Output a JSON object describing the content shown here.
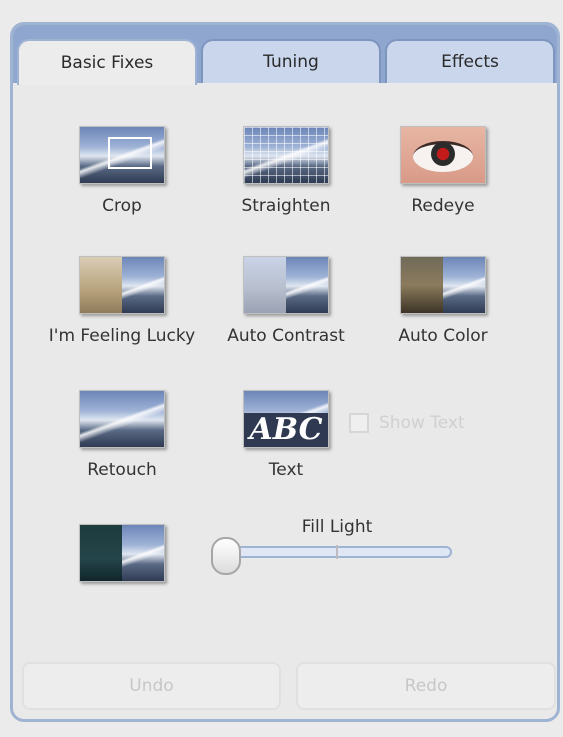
{
  "tabs": [
    {
      "label": "Basic Fixes",
      "active": true
    },
    {
      "label": "Tuning",
      "active": false
    },
    {
      "label": "Effects",
      "active": false
    }
  ],
  "tools": {
    "crop": "Crop",
    "straighten": "Straighten",
    "redeye": "Redeye",
    "feeling_lucky": "I'm Feeling Lucky",
    "auto_contrast": "Auto Contrast",
    "auto_color": "Auto Color",
    "retouch": "Retouch",
    "text": "Text",
    "text_thumb": "ABC"
  },
  "show_text": {
    "label": "Show Text",
    "checked": false,
    "enabled": false
  },
  "fill_light": {
    "label": "Fill Light",
    "value": 0
  },
  "buttons": {
    "undo": "Undo",
    "redo": "Redo"
  },
  "colors": {
    "tab_accent": "#8fa7cf",
    "panel_bg": "#e9e9e9",
    "disabled_text": "#c7c7c7"
  }
}
